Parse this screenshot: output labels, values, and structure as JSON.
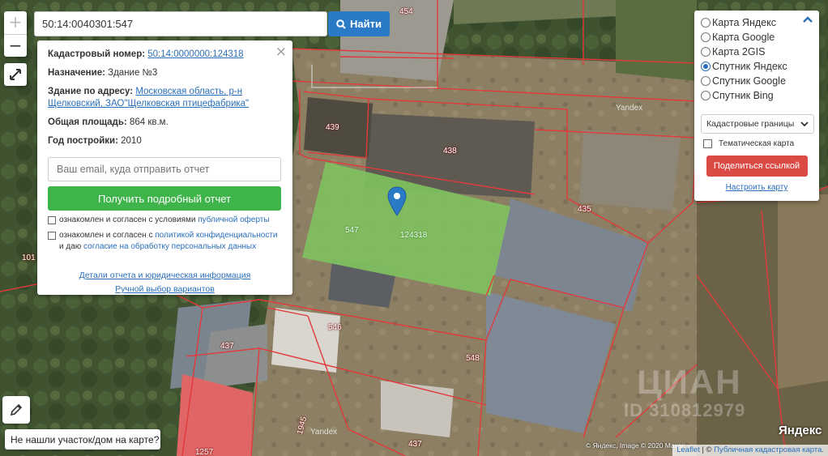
{
  "search": {
    "value": "50:14:0040301:547",
    "button_label": "Найти"
  },
  "info": {
    "cadastral_label": "Кадастровый номер:",
    "cadastral_value": "50:14:0000000:124318",
    "purpose_label": "Назначение:",
    "purpose_value": "Здание №3",
    "address_label": "Здание по адресу:",
    "address_value": "Московская область, р-н Щелковский, ЗАО\"Щелковская птицефабрика\"",
    "area_label": "Общая площадь:",
    "area_value": "864 кв.м.",
    "year_label": "Год постройки:",
    "year_value": "2010",
    "email_placeholder": "Ваш email, куда отправить отчет",
    "report_button": "Получить подробный отчет",
    "consent1_text": "ознакомлен и согласен с условиями ",
    "consent1_link": "публичной оферты",
    "consent2_text": "ознакомлен и согласен с ",
    "consent2_link1": "политикой конфиденциальности",
    "consent2_mid": " и даю ",
    "consent2_link2": "согласие на обработку персональных данных",
    "details_link": "Детали отчета и юридическая информация",
    "manual_link": "Ручной выбор вариантов"
  },
  "layers": {
    "options": [
      {
        "label": "Карта Яндекс",
        "selected": false
      },
      {
        "label": "Карта Google",
        "selected": false
      },
      {
        "label": "Карта 2GIS",
        "selected": false
      },
      {
        "label": "Спутник Яндекс",
        "selected": true
      },
      {
        "label": "Спутник Google",
        "selected": false
      },
      {
        "label": "Спутник Bing",
        "selected": false
      }
    ],
    "overlay_select": "Кадастровые границы",
    "thematic_label": "Тематическая карта",
    "share_button": "Поделиться ссылкой",
    "setup_link": "Настроить карту"
  },
  "map": {
    "parcels": [
      "454",
      "439",
      "438",
      "547",
      "124318",
      "435",
      "101",
      "546",
      "437",
      "548",
      "437",
      "1257",
      "1945"
    ],
    "yandex_marks": [
      "Yandex",
      "Yandex"
    ],
    "watermark": "ЦИАН",
    "watermark_id": "ID 310812979",
    "copyright": "© Яндекс, Image © 2020 Maxar",
    "yandex_logo": "Яндекс",
    "highlight_color": "#7fc15e",
    "boundary_color": "#e23a3a"
  },
  "bottom": {
    "not_found": "Не нашли участок/дом на карте?",
    "attr_leaflet": "Leaflet",
    "attr_sep": " | © ",
    "attr_public": "Публичная кадастровая карта",
    "attr_dot": "."
  },
  "icons": {
    "zoom_in": "+",
    "zoom_out": "−",
    "close": "×"
  }
}
